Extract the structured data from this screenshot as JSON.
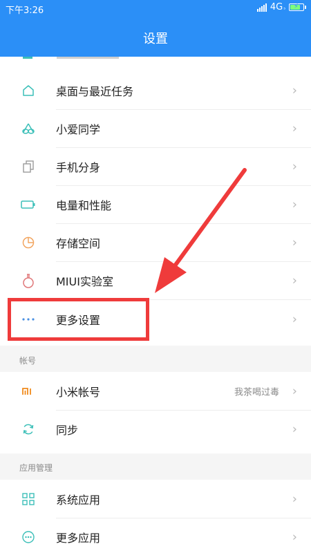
{
  "status_bar": {
    "time": "下午3:26",
    "network": "4G",
    "network_sub": "⁵",
    "battery_level": 0.85
  },
  "header": {
    "title": "设置"
  },
  "items": [
    {
      "label": "桌面与最近任务",
      "icon": "home-icon"
    },
    {
      "label": "小爱同学",
      "icon": "xiaoai-icon"
    },
    {
      "label": "手机分身",
      "icon": "dual-app-icon"
    },
    {
      "label": "电量和性能",
      "icon": "battery-icon"
    },
    {
      "label": "存储空间",
      "icon": "storage-pie-icon"
    },
    {
      "label": "MIUI实验室",
      "icon": "flask-icon"
    },
    {
      "label": "更多设置",
      "icon": "more-dots-icon"
    }
  ],
  "account_section": {
    "header": "帐号",
    "items": [
      {
        "label": "小米帐号",
        "value": "我茶喝过毒",
        "icon": "mi-logo-icon"
      },
      {
        "label": "同步",
        "icon": "sync-icon"
      }
    ]
  },
  "apps_section": {
    "header": "应用管理",
    "items": [
      {
        "label": "系统应用",
        "icon": "apps-grid-icon"
      },
      {
        "label": "更多应用",
        "icon": "more-apps-icon"
      }
    ]
  },
  "colors": {
    "header_bg": "#2b8ff7",
    "icon_teal": "#3bbfb8",
    "highlight": "#ef3b3b",
    "mi_orange": "#f08a1c"
  }
}
